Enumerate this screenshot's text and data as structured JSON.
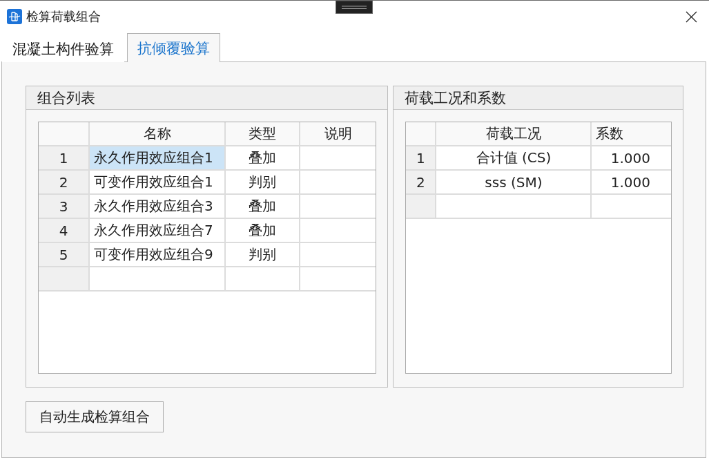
{
  "window": {
    "title": "检算荷载组合"
  },
  "tabs": [
    {
      "label": "混凝土构件验算",
      "selected": false
    },
    {
      "label": "抗倾覆验算",
      "selected": true
    }
  ],
  "combination_list": {
    "title": "组合列表",
    "columns": [
      "名称",
      "类型",
      "说明"
    ],
    "rows": [
      {
        "number": "1",
        "name": "永久作用效应组合1",
        "type": "叠加",
        "selected": true
      },
      {
        "number": "2",
        "name": "可变作用效应组合1",
        "type": "判别",
        "selected": false
      },
      {
        "number": "3",
        "name": "永久作用效应组合3",
        "type": "叠加",
        "selected": false
      },
      {
        "number": "4",
        "name": "永久作用效应组合7",
        "type": "叠加",
        "selected": false
      },
      {
        "number": "5",
        "name": "可变作用效应组合9",
        "type": "判别",
        "selected": false
      }
    ]
  },
  "load_cases": {
    "title": "荷载工况和系数",
    "columns": [
      "荷载工况",
      "系数"
    ],
    "rows": [
      {
        "number": "1",
        "load_case": "合计值 (CS)",
        "coefficient": "1.000",
        "selected": false
      },
      {
        "number": "2",
        "load_case": "sss (SM)",
        "coefficient": "1.000",
        "selected": false
      }
    ]
  },
  "buttons": [
    "自动生成检算组合"
  ]
}
